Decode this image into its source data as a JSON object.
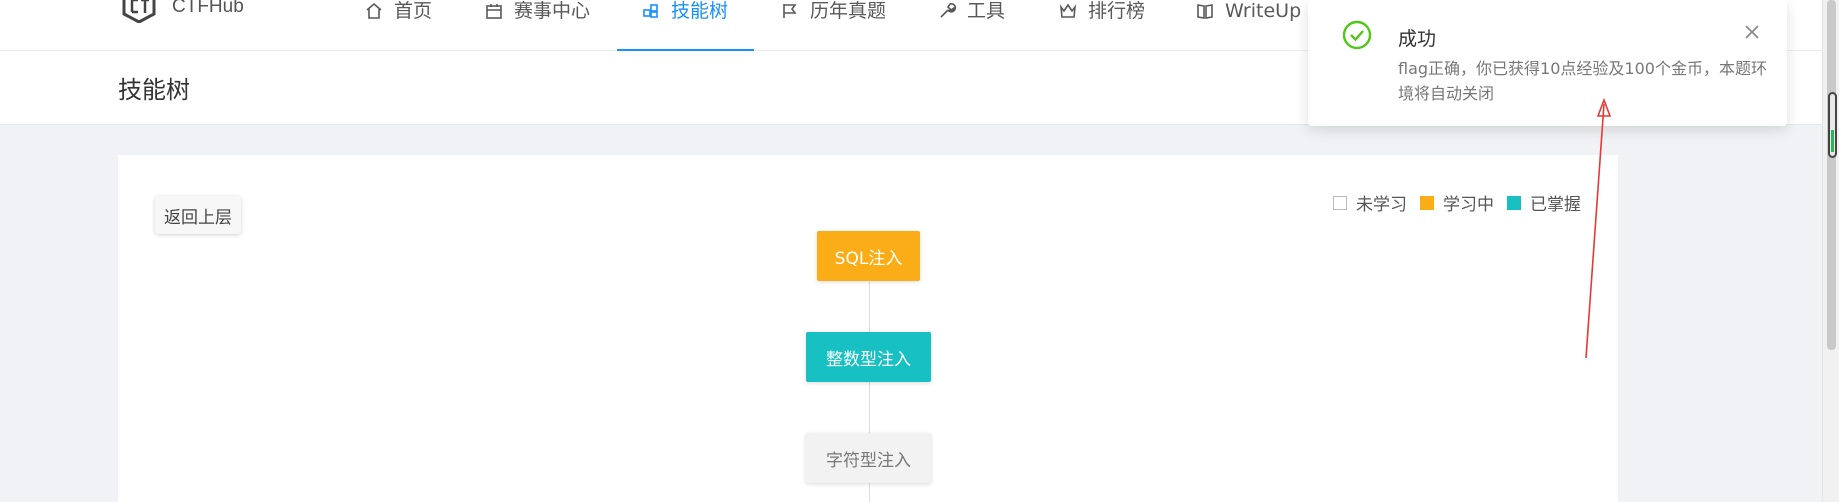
{
  "nav": {
    "brand": "CTFHub",
    "items": [
      {
        "label": "首页",
        "icon": "home-icon"
      },
      {
        "label": "赛事中心",
        "icon": "calendar-icon"
      },
      {
        "label": "技能树",
        "icon": "skill-tree-icon",
        "active": true
      },
      {
        "label": "历年真题",
        "icon": "flag-icon"
      },
      {
        "label": "工具",
        "icon": "wrench-icon"
      },
      {
        "label": "排行榜",
        "icon": "trophy-icon"
      },
      {
        "label": "WriteUp",
        "icon": "book-icon"
      }
    ]
  },
  "page": {
    "title": "技能树"
  },
  "back_button": "返回上层",
  "legend": {
    "not_learned": "未学习",
    "learning": "学习中",
    "mastered": "已掌握"
  },
  "colors": {
    "learning": "#fbad17",
    "mastered": "#17c0c2",
    "not_learned": "#f2f2f2",
    "accent": "#1890ff",
    "success": "#52c41a"
  },
  "tree": {
    "nodes": [
      {
        "label": "SQL注入",
        "status": "learning"
      },
      {
        "label": "整数型注入",
        "status": "mastered"
      },
      {
        "label": "字符型注入",
        "status": "not_learned"
      }
    ]
  },
  "toast": {
    "title": "成功",
    "message": "flag正确，你已获得10点经验及100个金币，本题环境将自动关闭",
    "icon": "check-circle-icon"
  }
}
